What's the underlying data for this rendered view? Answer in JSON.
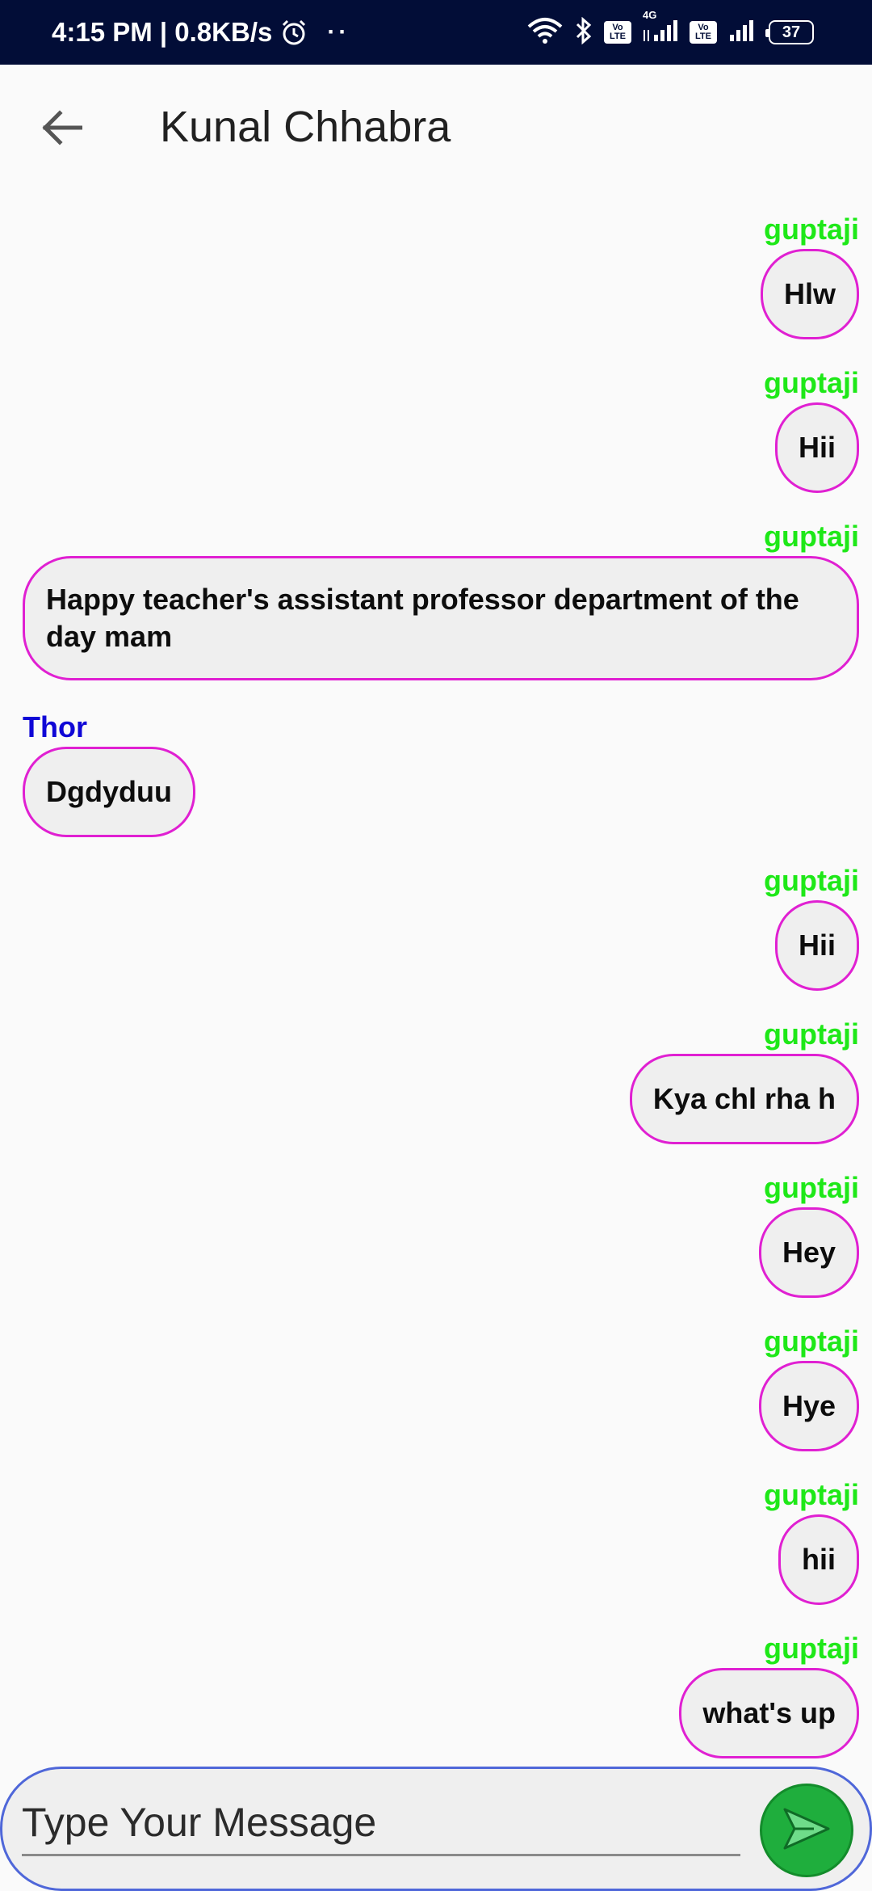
{
  "status_bar": {
    "time_speed": "4:15 PM | 0.8KB/s",
    "dots": "··",
    "volte1": "Vo LTE",
    "network": "4G",
    "volte2": "Vo LTE",
    "battery": "37"
  },
  "header": {
    "title": "Kunal Chhabra"
  },
  "messages": [
    {
      "sender": "guptaji",
      "text": "Hlw",
      "side": "right"
    },
    {
      "sender": "guptaji",
      "text": "Hii",
      "side": "right"
    },
    {
      "sender": "guptaji",
      "text": "Happy teacher's assistant professor department of the day mam",
      "side": "right"
    },
    {
      "sender": "Thor",
      "text": "Dgdyduu",
      "side": "left"
    },
    {
      "sender": "guptaji",
      "text": "Hii",
      "side": "right"
    },
    {
      "sender": "guptaji",
      "text": "Kya chl rha h",
      "side": "right"
    },
    {
      "sender": "guptaji",
      "text": "Hey",
      "side": "right"
    },
    {
      "sender": "guptaji",
      "text": "Hye",
      "side": "right"
    },
    {
      "sender": "guptaji",
      "text": "hii",
      "side": "right"
    },
    {
      "sender": "guptaji",
      "text": "what's up",
      "side": "right"
    }
  ],
  "input": {
    "placeholder": "Type Your Message"
  },
  "colors": {
    "status_bar_bg": "#020d37",
    "my_sender": "#1ee818",
    "other_sender": "#0f06d6",
    "bubble_border": "#e020d2",
    "send_button": "#1fae3d"
  }
}
